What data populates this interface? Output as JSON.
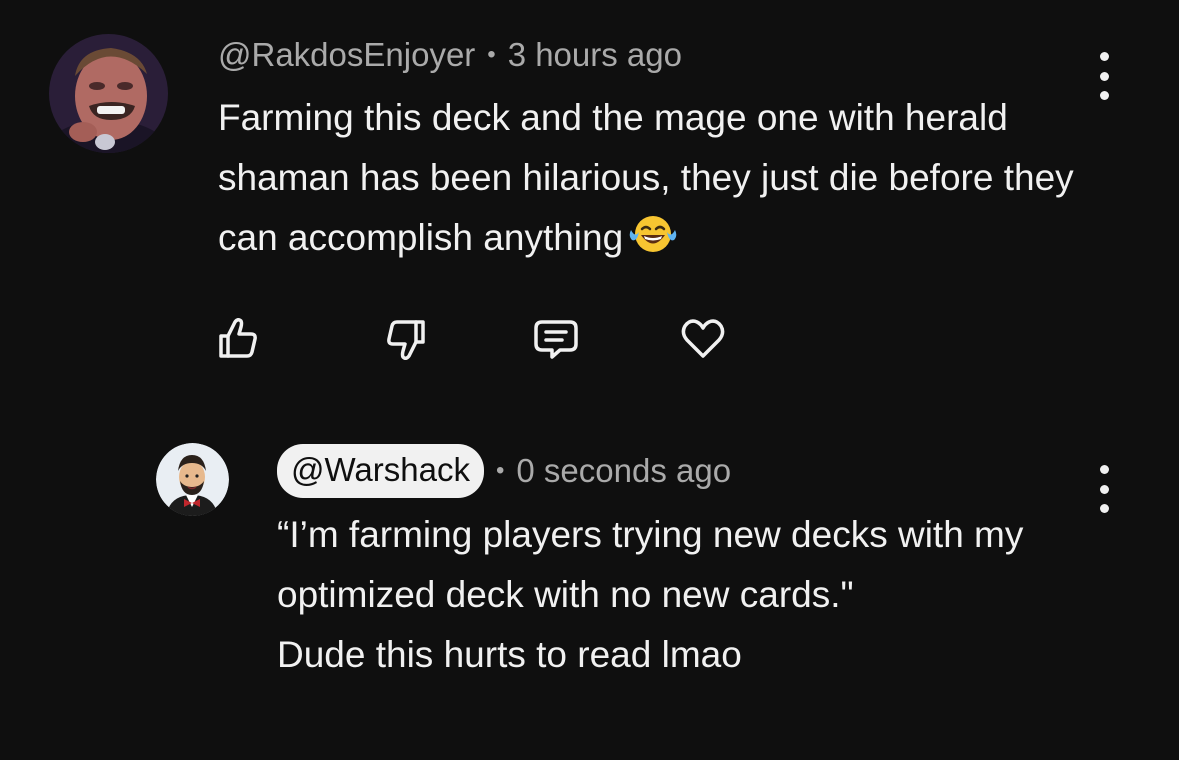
{
  "comment": {
    "author": "@RakdosEnjoyer",
    "separator": "•",
    "time": "3 hours ago",
    "text": "Farming this deck and the mage one with herald shaman has been hilarious, they just die before they can accomplish anything",
    "emoji": "face-with-tears-of-joy",
    "actions": [
      "like",
      "dislike",
      "reply",
      "heart"
    ]
  },
  "reply": {
    "author": "@Warshack",
    "separator": "•",
    "time": "0 seconds ago",
    "lines": [
      "“I’m farming players trying new decks with my optimized deck with no new cards.\"",
      "Dude this hurts to read lmao"
    ]
  },
  "colors": {
    "background": "#0f0f0f",
    "text": "#f1f1f1",
    "meta": "#aaaaaa",
    "pill": "#f1f1f1"
  }
}
